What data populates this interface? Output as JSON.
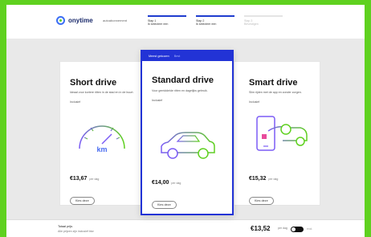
{
  "header": {
    "logo_text": "onytime",
    "logo_sub": "autoabonnement",
    "steps": [
      {
        "number": "Stap 1",
        "label": "Ik selecteer een",
        "state": "active"
      },
      {
        "number": "Stap 2",
        "label": "Ik selecteer een",
        "state": "active"
      },
      {
        "number": "Stap 3",
        "label": "Bevestigen",
        "state": "dim"
      }
    ]
  },
  "banner": {
    "text": "Meest gekozen",
    "tag": "Best"
  },
  "plans": [
    {
      "title": "Short drive",
      "desc": "Ideaal voor kortere ritten in de stad en in de buurt.",
      "note": "Inclusief",
      "price": "€13,67",
      "price_unit": "per dag",
      "button": "Kies deze",
      "icon": "speedometer-icon",
      "icon_text": "km"
    },
    {
      "title": "Standard drive",
      "desc": "Voor gemiddelde ritten en dagelijks gebruik.",
      "note": "Inclusief",
      "price": "€14,00",
      "price_unit": "per dag",
      "button": "Kies deze",
      "icon": "car-icon"
    },
    {
      "title": "Smart drive",
      "desc": "Slim rijden met de app en zonder zorgen.",
      "note": "Inclusief",
      "price": "€15,32",
      "price_unit": "per dag",
      "button": "Kies deze",
      "icon": "phone-car-icon"
    }
  ],
  "footer": {
    "line1": "Totaal prijs",
    "line2": "Alle prijzen zijn inclusief btw",
    "total": "€13,52",
    "total_unit": "per dag",
    "toggle_label": "excl."
  },
  "colors": {
    "accent": "#2233d6",
    "brand_green": "#5fd11f",
    "icon_gradient_start": "#7b5cf5",
    "icon_gradient_end": "#5fd11f"
  }
}
